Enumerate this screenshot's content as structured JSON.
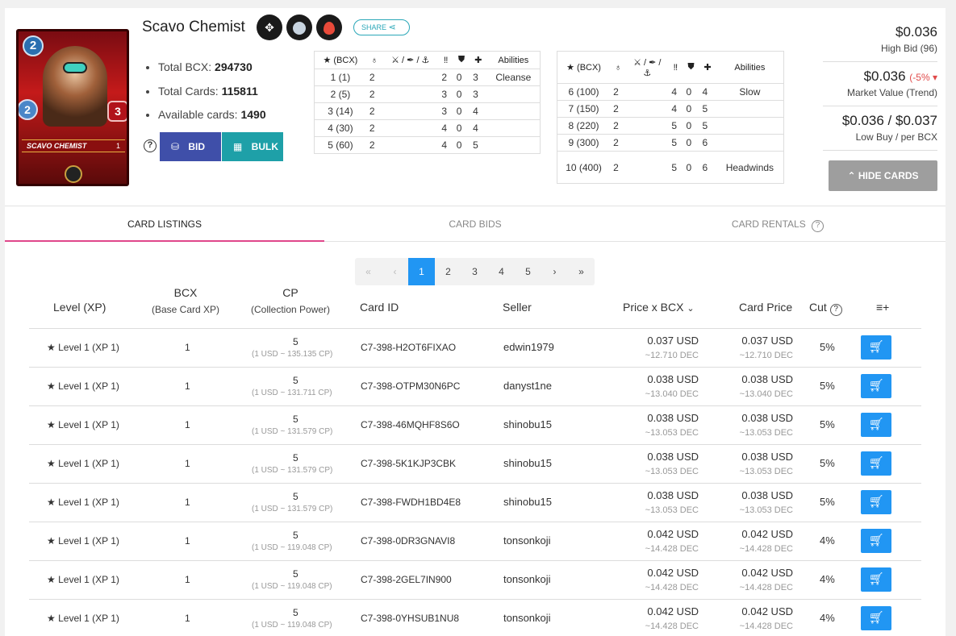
{
  "card": {
    "name": "Scavo Chemist",
    "card_name_banner": "SCAVO CHEMIST",
    "mana": "2",
    "attack": "2",
    "health": "3",
    "level_badge": "1",
    "element_icons": [
      "cross-diamond-icon",
      "circle-icon",
      "fire-icon"
    ],
    "share_label": "SHARE",
    "stats": [
      {
        "label": "Total BCX:",
        "value": "294730"
      },
      {
        "label": "Total Cards:",
        "value": "115811"
      },
      {
        "label": "Available cards:",
        "value": "1490"
      }
    ],
    "bid_label": "BID",
    "bulk_label": "BULK"
  },
  "level_table_left": {
    "headers": [
      "(BCX)",
      "",
      "",
      "",
      "",
      "",
      "Abilities"
    ],
    "rows": [
      [
        "1 (1)",
        "2",
        "2",
        "0",
        "3",
        "Cleanse"
      ],
      [
        "2 (5)",
        "2",
        "3",
        "0",
        "3",
        ""
      ],
      [
        "3 (14)",
        "2",
        "3",
        "0",
        "4",
        ""
      ],
      [
        "4 (30)",
        "2",
        "4",
        "0",
        "4",
        ""
      ],
      [
        "5 (60)",
        "2",
        "4",
        "0",
        "5",
        ""
      ]
    ]
  },
  "level_table_right": {
    "headers": [
      "(BCX)",
      "",
      "",
      "",
      "",
      "",
      "Abilities"
    ],
    "rows": [
      [
        "6 (100)",
        "2",
        "4",
        "0",
        "4",
        "Slow"
      ],
      [
        "7 (150)",
        "2",
        "4",
        "0",
        "5",
        ""
      ],
      [
        "8 (220)",
        "2",
        "5",
        "0",
        "5",
        ""
      ],
      [
        "9 (300)",
        "2",
        "5",
        "0",
        "6",
        ""
      ],
      [
        "10 (400)",
        "2",
        "5",
        "0",
        "6",
        "Headwinds"
      ]
    ]
  },
  "prices": {
    "high_bid": "$0.036",
    "high_bid_label": "High Bid (96)",
    "market": "$0.036",
    "market_trend": "(-5%",
    "market_label": "Market Value (Trend)",
    "low_buy": "$0.036 / $0.037",
    "low_buy_label": "Low Buy / per BCX",
    "hide_label": "HIDE CARDS"
  },
  "tabs": [
    "CARD LISTINGS",
    "CARD BIDS",
    "CARD RENTALS"
  ],
  "pager": [
    "«",
    "‹",
    "1",
    "2",
    "3",
    "4",
    "5",
    "›",
    "»"
  ],
  "columns": {
    "level": "Level (XP)",
    "bcx": "BCX",
    "bcx_sub": "(Base Card XP)",
    "cp": "CP",
    "cp_sub": "(Collection Power)",
    "card_id": "Card ID",
    "seller": "Seller",
    "price_bcx": "Price x BCX",
    "card_price": "Card Price",
    "cut": "Cut"
  },
  "listings": [
    {
      "level": "Level 1",
      "xp": "(XP 1)",
      "bcx": "1",
      "cp": "5",
      "cp_sub": "(1 USD ~ 135.135 CP)",
      "id": "C7-398-H2OT6FIXAO",
      "seller": "edwin1979",
      "pbcx": "0.037 USD",
      "pbcx_dec": "~12.710 DEC",
      "price": "0.037 USD",
      "price_dec": "~12.710 DEC",
      "cut": "5%"
    },
    {
      "level": "Level 1",
      "xp": "(XP 1)",
      "bcx": "1",
      "cp": "5",
      "cp_sub": "(1 USD ~ 131.711 CP)",
      "id": "C7-398-OTPM30N6PC",
      "seller": "danyst1ne",
      "pbcx": "0.038 USD",
      "pbcx_dec": "~13.040 DEC",
      "price": "0.038 USD",
      "price_dec": "~13.040 DEC",
      "cut": "5%"
    },
    {
      "level": "Level 1",
      "xp": "(XP 1)",
      "bcx": "1",
      "cp": "5",
      "cp_sub": "(1 USD ~ 131.579 CP)",
      "id": "C7-398-46MQHF8S6O",
      "seller": "shinobu15",
      "pbcx": "0.038 USD",
      "pbcx_dec": "~13.053 DEC",
      "price": "0.038 USD",
      "price_dec": "~13.053 DEC",
      "cut": "5%"
    },
    {
      "level": "Level 1",
      "xp": "(XP 1)",
      "bcx": "1",
      "cp": "5",
      "cp_sub": "(1 USD ~ 131.579 CP)",
      "id": "C7-398-5K1KJP3CBK",
      "seller": "shinobu15",
      "pbcx": "0.038 USD",
      "pbcx_dec": "~13.053 DEC",
      "price": "0.038 USD",
      "price_dec": "~13.053 DEC",
      "cut": "5%"
    },
    {
      "level": "Level 1",
      "xp": "(XP 1)",
      "bcx": "1",
      "cp": "5",
      "cp_sub": "(1 USD ~ 131.579 CP)",
      "id": "C7-398-FWDH1BD4E8",
      "seller": "shinobu15",
      "pbcx": "0.038 USD",
      "pbcx_dec": "~13.053 DEC",
      "price": "0.038 USD",
      "price_dec": "~13.053 DEC",
      "cut": "5%"
    },
    {
      "level": "Level 1",
      "xp": "(XP 1)",
      "bcx": "1",
      "cp": "5",
      "cp_sub": "(1 USD ~ 119.048 CP)",
      "id": "C7-398-0DR3GNAVI8",
      "seller": "tonsonkoji",
      "pbcx": "0.042 USD",
      "pbcx_dec": "~14.428 DEC",
      "price": "0.042 USD",
      "price_dec": "~14.428 DEC",
      "cut": "4%"
    },
    {
      "level": "Level 1",
      "xp": "(XP 1)",
      "bcx": "1",
      "cp": "5",
      "cp_sub": "(1 USD ~ 119.048 CP)",
      "id": "C7-398-2GEL7IN900",
      "seller": "tonsonkoji",
      "pbcx": "0.042 USD",
      "pbcx_dec": "~14.428 DEC",
      "price": "0.042 USD",
      "price_dec": "~14.428 DEC",
      "cut": "4%"
    },
    {
      "level": "Level 1",
      "xp": "(XP 1)",
      "bcx": "1",
      "cp": "5",
      "cp_sub": "(1 USD ~ 119.048 CP)",
      "id": "C7-398-0YHSUB1NU8",
      "seller": "tonsonkoji",
      "pbcx": "0.042 USD",
      "pbcx_dec": "~14.428 DEC",
      "price": "0.042 USD",
      "price_dec": "~14.428 DEC",
      "cut": "4%"
    }
  ]
}
